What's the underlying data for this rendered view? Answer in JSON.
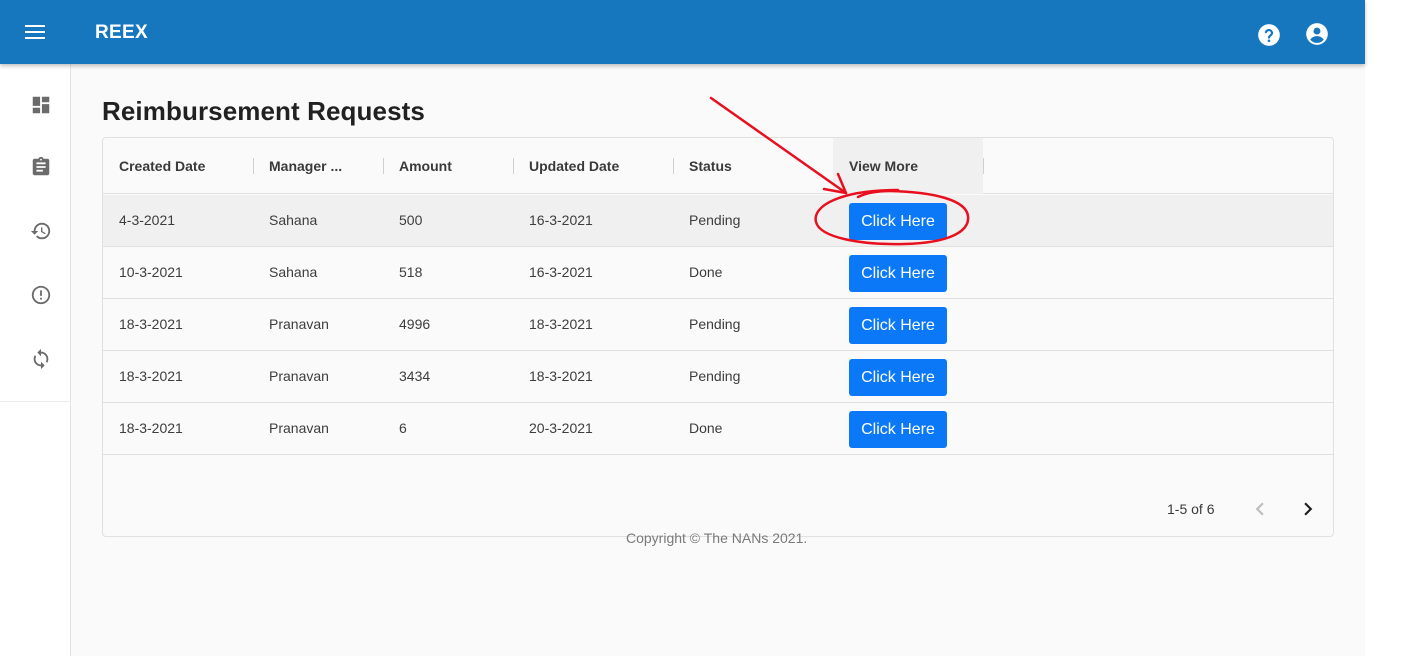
{
  "app": {
    "title": "REEX"
  },
  "icons": {
    "menu": "menu-icon",
    "help": "help-circle-icon",
    "account": "account-circle-icon",
    "nav": [
      "dashboard-icon",
      "clipboard-icon",
      "history-icon",
      "alert-circle-icon",
      "sync-icon"
    ]
  },
  "page": {
    "heading": "Reimbursement Requests"
  },
  "table": {
    "columns": [
      "Created Date",
      "Manager ...",
      "Amount",
      "Updated Date",
      "Status",
      "View More"
    ],
    "rows": [
      {
        "created": "4-3-2021",
        "manager": "Sahana",
        "amount": "500",
        "updated": "16-3-2021",
        "status": "Pending",
        "action": "Click Here"
      },
      {
        "created": "10-3-2021",
        "manager": "Sahana",
        "amount": "518",
        "updated": "16-3-2021",
        "status": "Done",
        "action": "Click Here"
      },
      {
        "created": "18-3-2021",
        "manager": "Pranavan",
        "amount": "4996",
        "updated": "18-3-2021",
        "status": "Pending",
        "action": "Click Here"
      },
      {
        "created": "18-3-2021",
        "manager": "Pranavan",
        "amount": "3434",
        "updated": "18-3-2021",
        "status": "Pending",
        "action": "Click Here"
      },
      {
        "created": "18-3-2021",
        "manager": "Pranavan",
        "amount": "6",
        "updated": "20-3-2021",
        "status": "Done",
        "action": "Click Here"
      }
    ]
  },
  "pagination": {
    "range": "1-5 of 6"
  },
  "footer": {
    "copyright": "Copyright © The NANs 2021."
  },
  "colors": {
    "appbar": "#1777be",
    "button": "#0b79f7",
    "annotation": "#e8101f"
  }
}
